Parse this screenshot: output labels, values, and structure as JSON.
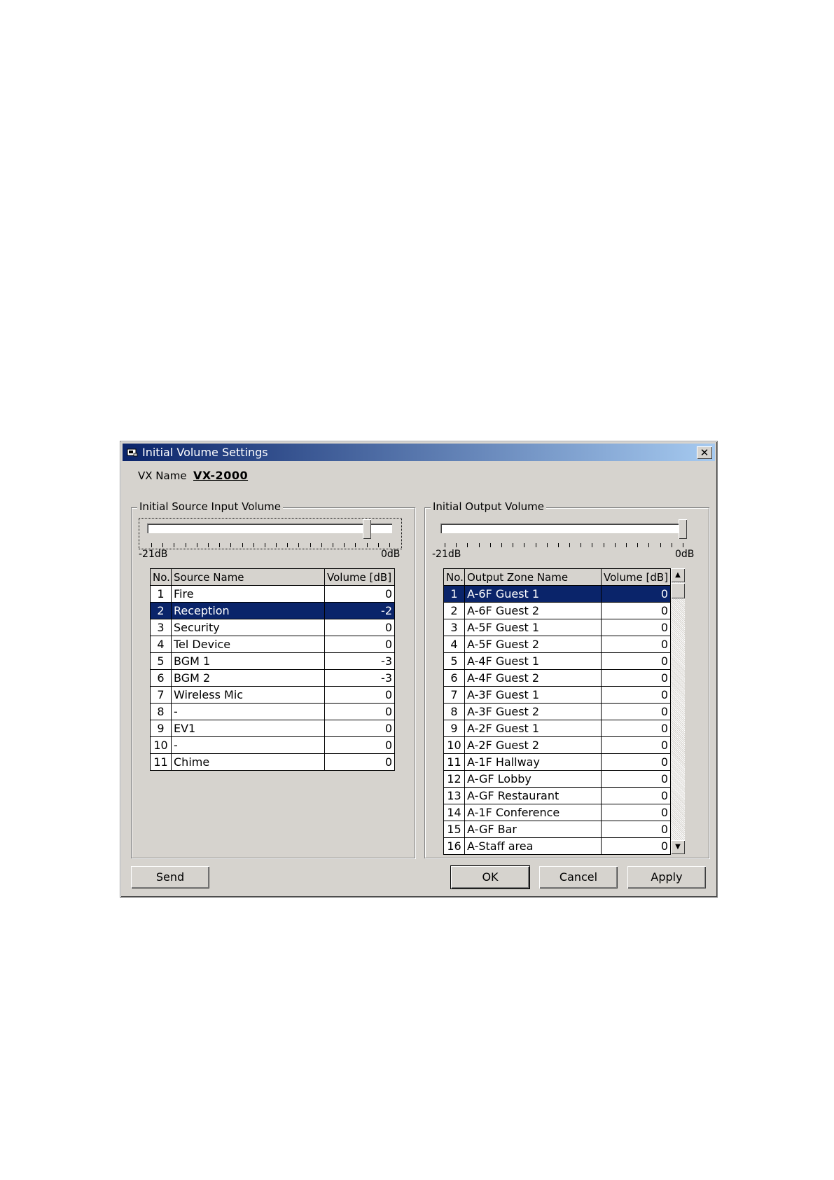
{
  "window": {
    "title": "Initial Volume Settings",
    "close_glyph": "✕"
  },
  "vx_name": {
    "label": "VX Name",
    "value": "VX-2000"
  },
  "source": {
    "group_label": "Initial Source Input Volume",
    "min_label": "-21dB",
    "max_label": "0dB",
    "slider_value_db": -2,
    "columns": [
      "No.",
      "Source Name",
      "Volume [dB]"
    ],
    "selected_no": "2",
    "rows": [
      {
        "no": "1",
        "name": "Fire",
        "vol": "0"
      },
      {
        "no": "2",
        "name": "Reception",
        "vol": "-2"
      },
      {
        "no": "3",
        "name": "Security",
        "vol": "0"
      },
      {
        "no": "4",
        "name": "Tel Device",
        "vol": "0"
      },
      {
        "no": "5",
        "name": "BGM 1",
        "vol": "-3"
      },
      {
        "no": "6",
        "name": "BGM 2",
        "vol": "-3"
      },
      {
        "no": "7",
        "name": "Wireless Mic",
        "vol": "0"
      },
      {
        "no": "8",
        "name": "-",
        "vol": "0"
      },
      {
        "no": "9",
        "name": "EV1",
        "vol": "0"
      },
      {
        "no": "10",
        "name": "-",
        "vol": "0"
      },
      {
        "no": "11",
        "name": "Chime",
        "vol": "0"
      }
    ]
  },
  "output": {
    "group_label": "Initial Output Volume",
    "min_label": "-21dB",
    "max_label": "0dB",
    "slider_value_db": 0,
    "columns": [
      "No.",
      "Output Zone Name",
      "Volume [dB]"
    ],
    "selected_no": "1",
    "rows": [
      {
        "no": "1",
        "name": "A-6F Guest 1",
        "vol": "0"
      },
      {
        "no": "2",
        "name": "A-6F Guest 2",
        "vol": "0"
      },
      {
        "no": "3",
        "name": "A-5F Guest 1",
        "vol": "0"
      },
      {
        "no": "4",
        "name": "A-5F Guest 2",
        "vol": "0"
      },
      {
        "no": "5",
        "name": "A-4F Guest 1",
        "vol": "0"
      },
      {
        "no": "6",
        "name": "A-4F Guest 2",
        "vol": "0"
      },
      {
        "no": "7",
        "name": "A-3F Guest 1",
        "vol": "0"
      },
      {
        "no": "8",
        "name": "A-3F Guest 2",
        "vol": "0"
      },
      {
        "no": "9",
        "name": "A-2F Guest 1",
        "vol": "0"
      },
      {
        "no": "10",
        "name": "A-2F Guest 2",
        "vol": "0"
      },
      {
        "no": "11",
        "name": "A-1F Hallway",
        "vol": "0"
      },
      {
        "no": "12",
        "name": "A-GF Lobby",
        "vol": "0"
      },
      {
        "no": "13",
        "name": "A-GF Restaurant",
        "vol": "0"
      },
      {
        "no": "14",
        "name": "A-1F Conference",
        "vol": "0"
      },
      {
        "no": "15",
        "name": "A-GF Bar",
        "vol": "0"
      },
      {
        "no": "16",
        "name": "A-Staff area",
        "vol": "0"
      }
    ],
    "scroll_up_glyph": "▲",
    "scroll_down_glyph": "▼"
  },
  "buttons": {
    "send": "Send",
    "ok": "OK",
    "cancel": "Cancel",
    "apply": "Apply"
  },
  "colors": {
    "selection": "#0a246a",
    "title_start": "#0a246a",
    "title_end": "#a6caf0",
    "face": "#d6d3ce"
  }
}
